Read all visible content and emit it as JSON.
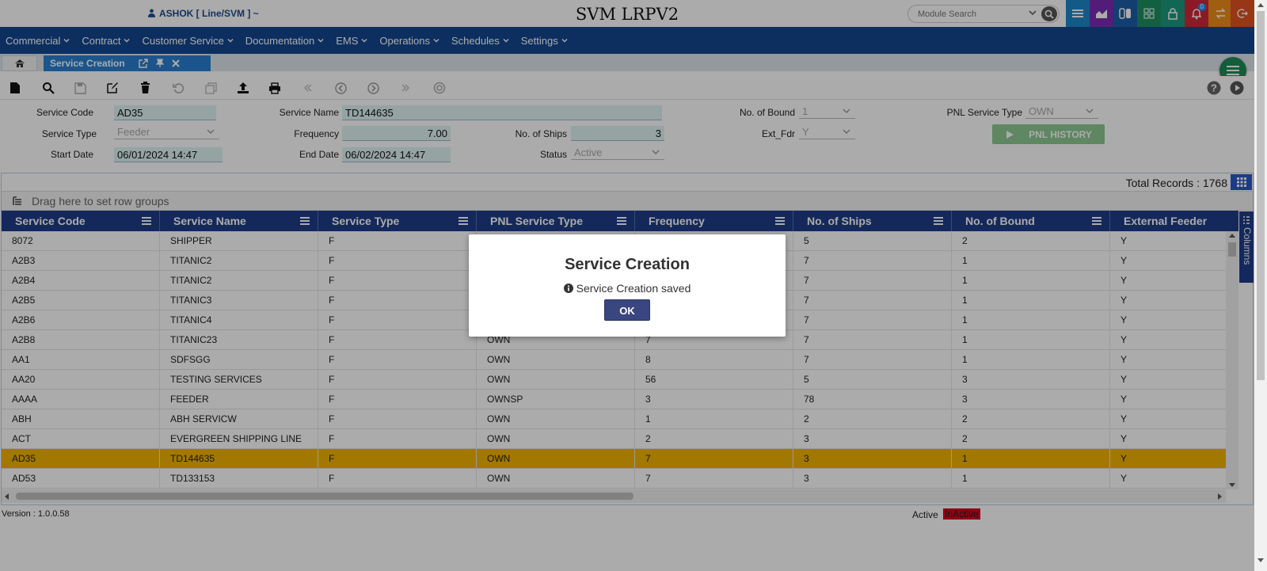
{
  "header": {
    "user": "ASHOK [ Line/SVM ] ~",
    "app_title": "SVM LRPV2",
    "module_search_placeholder": "Module Search",
    "notifications_count": "0"
  },
  "nav": {
    "items": [
      "Commercial",
      "Contract",
      "Customer Service",
      "Documentation",
      "EMS",
      "Operations",
      "Schedules",
      "Settings"
    ]
  },
  "tabs": {
    "active": "Service Creation"
  },
  "form": {
    "service_code_label": "Service Code",
    "service_code": "AD35",
    "service_name_label": "Service Name",
    "service_name": "TD144635",
    "no_of_bound_label": "No. of Bound",
    "no_of_bound": "1",
    "pnl_service_type_label": "PNL Service Type",
    "pnl_service_type": "OWN",
    "service_type_label": "Service Type",
    "service_type": "Feeder",
    "frequency_label": "Frequency",
    "frequency": "7.00",
    "no_of_ships_label": "No. of Ships",
    "no_of_ships": "3",
    "ext_fdr_label": "Ext_Fdr",
    "ext_fdr": "Y",
    "start_date_label": "Start Date",
    "start_date": "06/01/2024 14:47",
    "end_date_label": "End Date",
    "end_date": "06/02/2024 14:47",
    "status_label": "Status",
    "status": "Active",
    "pnl_history_label": "PNL HISTORY"
  },
  "grid": {
    "total_records": "Total Records : 1768",
    "group_hint": "Drag here to set row groups",
    "columns_label": "Columns",
    "headers": [
      "Service Code",
      "Service Name",
      "Service Type",
      "PNL Service Type",
      "Frequency",
      "No. of Ships",
      "No. of Bound",
      "External Feeder"
    ],
    "rows": [
      [
        "8072",
        "SHIPPER",
        "F",
        "",
        "",
        "5",
        "2",
        "Y"
      ],
      [
        "A2B3",
        "TITANIC2",
        "F",
        "",
        "",
        "7",
        "1",
        "Y"
      ],
      [
        "A2B4",
        "TITANIC2",
        "F",
        "",
        "",
        "7",
        "1",
        "Y"
      ],
      [
        "A2B5",
        "TITANIC3",
        "F",
        "",
        "",
        "7",
        "1",
        "Y"
      ],
      [
        "A2B6",
        "TITANIC4",
        "F",
        "",
        "",
        "7",
        "1",
        "Y"
      ],
      [
        "A2B8",
        "TITANIC23",
        "F",
        "OWN",
        "7",
        "7",
        "1",
        "Y"
      ],
      [
        "AA1",
        "SDFSGG",
        "F",
        "OWN",
        "8",
        "7",
        "1",
        "Y"
      ],
      [
        "AA20",
        "TESTING SERVICES",
        "F",
        "OWN",
        "56",
        "5",
        "3",
        "Y"
      ],
      [
        "AAAA",
        "FEEDER",
        "F",
        "OWNSP",
        "3",
        "78",
        "3",
        "Y"
      ],
      [
        "ABH",
        "ABH SERVICW",
        "F",
        "OWN",
        "1",
        "2",
        "2",
        "Y"
      ],
      [
        "ACT",
        "EVERGREEN SHIPPING LINE",
        "F",
        "OWN",
        "2",
        "3",
        "2",
        "Y"
      ],
      [
        "AD35",
        "TD144635",
        "F",
        "OWN",
        "7",
        "3",
        "1",
        "Y"
      ],
      [
        "AD53",
        "TD133153",
        "F",
        "OWN",
        "7",
        "3",
        "1",
        "Y"
      ]
    ],
    "selected_row_index": 11
  },
  "footer": {
    "version": "Version : 1.0.0.58",
    "legend_active": "Active",
    "legend_inactive": "InActive"
  },
  "modal": {
    "title": "Service Creation",
    "message": "Service Creation saved",
    "ok_label": "OK"
  },
  "colors": {
    "nav_bg": "#14468f",
    "grid_header_bg": "#1f3d8a",
    "selected_row": "#f4b400",
    "tab_active": "#2a7fd0",
    "inactive_badge": "#d8001c"
  }
}
